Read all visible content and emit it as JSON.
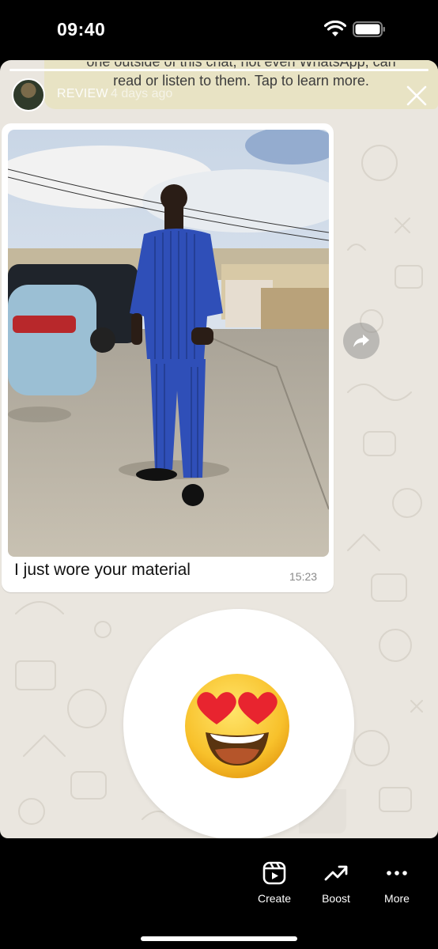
{
  "status_bar": {
    "time": "09:40"
  },
  "story": {
    "progress": 1.0,
    "poster_name": "REVIEW",
    "posted_ago": "4 days ago",
    "privacy_banner": {
      "line1": "one outside of this chat, not even WhatsApp, can",
      "line2": "read or listen to them. Tap to learn more."
    }
  },
  "message": {
    "caption": "I just wore your material",
    "time": "15:23"
  },
  "reaction": {
    "emoji_name": "smiling-face-with-heart-eyes"
  },
  "actions": [
    {
      "label": "Create",
      "icon": "reel-icon"
    },
    {
      "label": "Boost",
      "icon": "trend-up-icon"
    },
    {
      "label": "More",
      "icon": "ellipsis-icon"
    }
  ],
  "colors": {
    "background": "#eae6df",
    "banner": "#e8e3c4",
    "suit": "#2f4fb8"
  }
}
